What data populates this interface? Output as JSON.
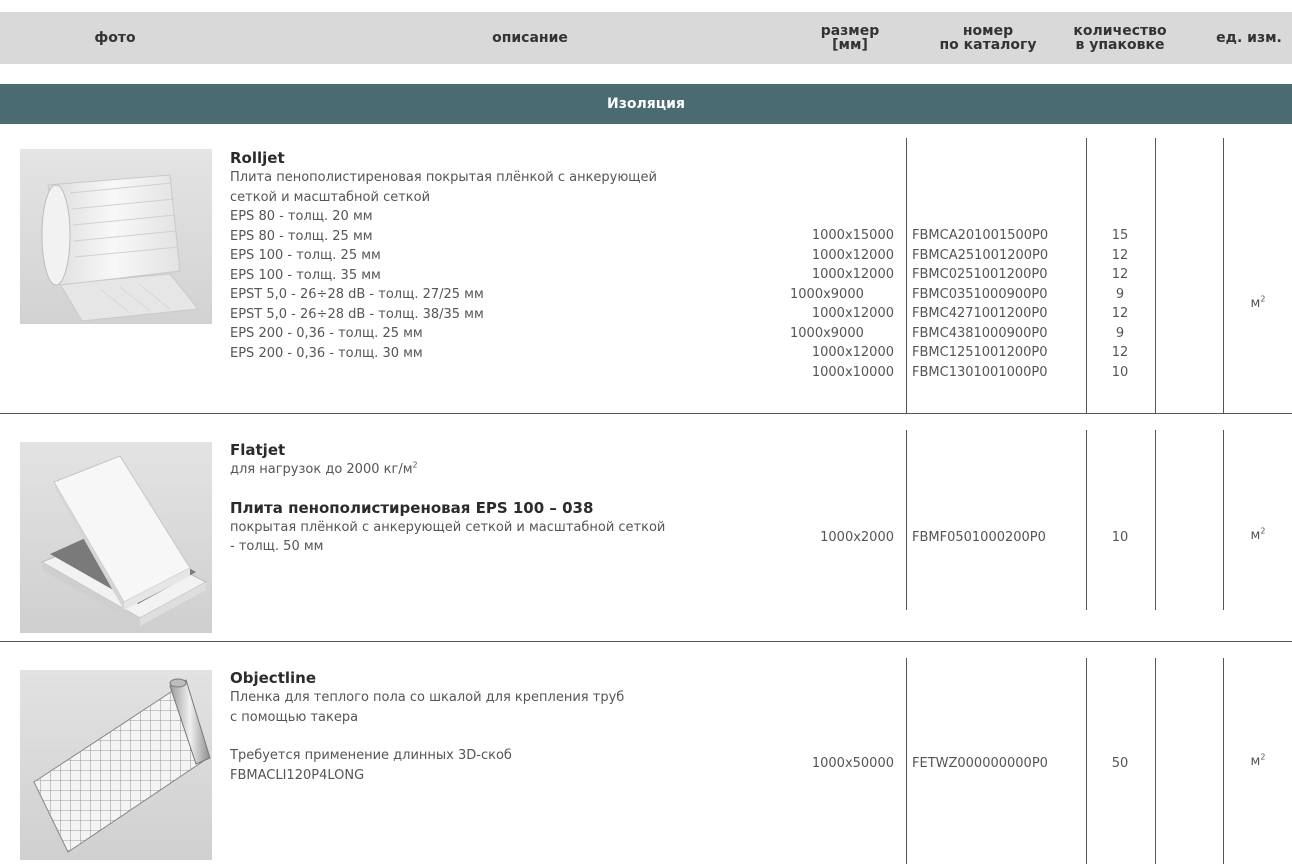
{
  "header": {
    "photo": "фото",
    "description": "описание",
    "size_line1": "размер",
    "size_line2": "[мм]",
    "catalog_line1": "номер",
    "catalog_line2": "по каталогу",
    "qty_line1": "количество",
    "qty_line2": "в упаковке",
    "unit": "ед. изм."
  },
  "section": {
    "title": "Изоляция"
  },
  "products": [
    {
      "name": "Rolljet",
      "intro": [
        "Плита пенополистиреновая покрытая плёнкой с анкерующей",
        "сеткой и масштабной сеткой"
      ],
      "variants": [
        {
          "desc": "EPS 80 - толщ. 20 мм",
          "size": "1000x15000",
          "catalog": "FBMCA201001500P0",
          "qty": "15"
        },
        {
          "desc": "EPS 80 - толщ. 25 мм",
          "size": "1000x12000",
          "catalog": "FBMCA251001200P0",
          "qty": "12"
        },
        {
          "desc": "EPS 100 - толщ. 25 мм",
          "size": "1000x12000",
          "catalog": "FBMC0251001200P0",
          "qty": "12"
        },
        {
          "desc": "EPS 100 - толщ. 35 мм",
          "size": "1000x9000",
          "catalog": "FBMC0351000900P0",
          "qty": "9"
        },
        {
          "desc": "EPST 5,0 - 26÷28 dB - толщ. 27/25 мм",
          "size": "1000x12000",
          "catalog": "FBMC4271001200P0",
          "qty": "12"
        },
        {
          "desc": "EPST 5,0 - 26÷28 dB - толщ. 38/35 мм",
          "size": "1000x9000",
          "catalog": "FBMC4381000900P0",
          "qty": "9"
        },
        {
          "desc": "EPS 200 - 0,36 - толщ. 25 мм",
          "size": "1000x12000",
          "catalog": "FBMC1251001200P0",
          "qty": "12"
        },
        {
          "desc": "EPS 200 - 0,36 - толщ. 30 мм",
          "size": "1000x10000",
          "catalog": "FBMC1301001000P0",
          "qty": "10"
        }
      ],
      "unit_base": "м",
      "unit_sup": "2"
    },
    {
      "name": "Flatjet",
      "intro_base": "для нагрузок до 2000 кг/м",
      "intro_sup": "2",
      "subtitle": "Плита пенополистиреновая EPS 100 – 038",
      "lines": [
        "покрытая плёнкой с анкерующей сеткой и масштабной сеткой",
        "- толщ. 50 мм"
      ],
      "size": "1000x2000",
      "catalog": "FBMF0501000200P0",
      "qty": "10",
      "unit_base": "м",
      "unit_sup": "2"
    },
    {
      "name": "Objectline",
      "lines": [
        "Пленка для теплого пола со шкалой для крепления труб",
        "с помощью такера"
      ],
      "note": [
        "Требуется применение длинных 3D-скоб",
        "FBMACLI120P4LONG"
      ],
      "size": "1000x50000",
      "catalog": "FETWZ000000000P0",
      "qty": "50",
      "unit_base": "м",
      "unit_sup": "2"
    }
  ]
}
